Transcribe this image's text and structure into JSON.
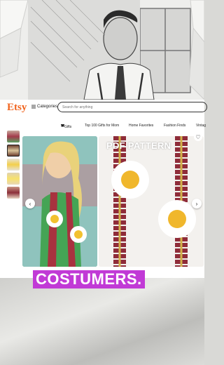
{
  "header": {
    "logo": "Etsy",
    "categories_label": "Categories",
    "search_placeholder": "Search for anything"
  },
  "nav": {
    "items": [
      "Gifts",
      "Top 100 Gifts for Mom",
      "Home Favorites",
      "Fashion Finds",
      "Vintag"
    ]
  },
  "listing": {
    "overlay_text": "PDF PATTERN"
  },
  "caption": "COSTUMERS.",
  "colors": {
    "etsy_orange": "#f1641e",
    "caption_bg": "#c13ad6"
  },
  "icons": [
    "gift-icon",
    "menu-icon",
    "chevron-left-icon",
    "chevron-right-icon",
    "heart-icon"
  ]
}
